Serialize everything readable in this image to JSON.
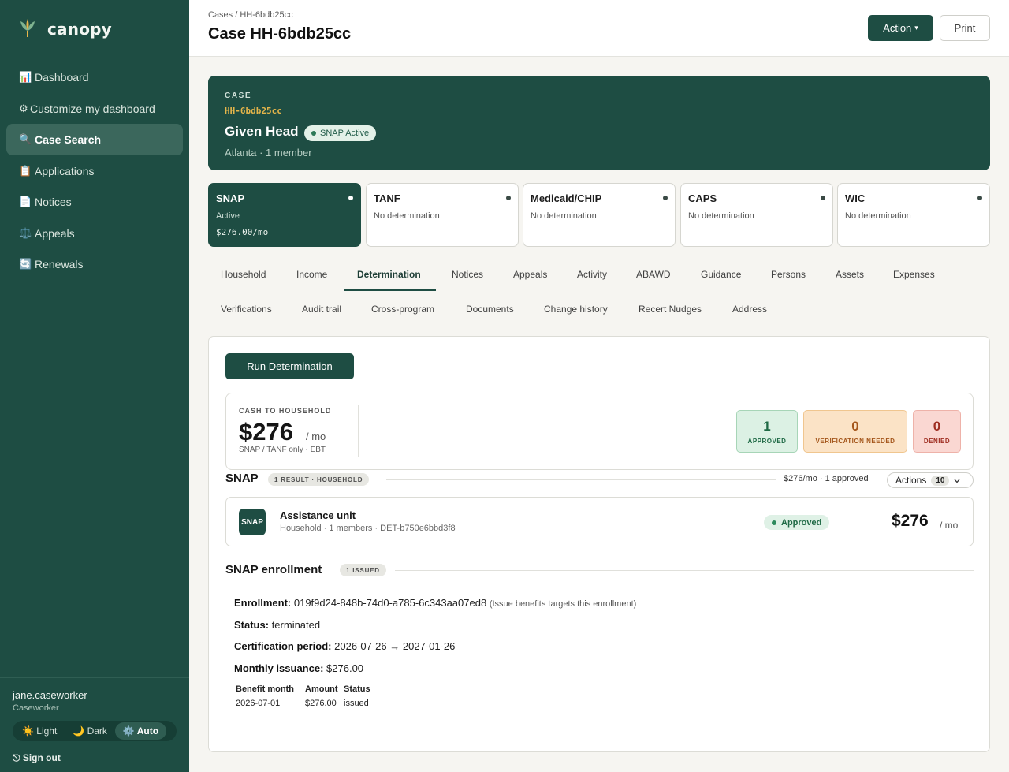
{
  "sidebar": {
    "brand": "canopy",
    "items": [
      {
        "icon": "📊",
        "label": "Dashboard"
      },
      {
        "icon": "⚙",
        "label": "Customize my dashboard"
      },
      {
        "icon": "🔍",
        "label": "Case Search"
      },
      {
        "icon": "📋",
        "label": "Applications"
      },
      {
        "icon": "📄",
        "label": "Notices"
      },
      {
        "icon": "⚖️",
        "label": "Appeals"
      },
      {
        "icon": "🔄",
        "label": "Renewals"
      }
    ],
    "active_item": "Case Search",
    "user": {
      "name": "jane.caseworker",
      "role": "Caseworker"
    },
    "theme": {
      "light": "☀️ Light",
      "dark": "🌙 Dark",
      "auto": "⚙️ Auto",
      "selected": "Auto"
    },
    "signout": "⎋ Sign out",
    "accent": "#1e4d43"
  },
  "header": {
    "breadcrumb": "Cases / HH-6bdb25cc",
    "title": "Case HH-6bdb25cc",
    "action_label": "Action",
    "action_caret": "▾",
    "print_label": "Print"
  },
  "case": {
    "label": "CASE",
    "id": "HH-6bdb25cc",
    "name": "Given Head",
    "badge": "SNAP Active",
    "subtitle": "Atlanta · 1 member"
  },
  "programs": [
    {
      "name": "SNAP",
      "status": "Active",
      "amount": "$276.00/mo"
    },
    {
      "name": "TANF",
      "status": "No determination"
    },
    {
      "name": "Medicaid/CHIP",
      "status": "No determination"
    },
    {
      "name": "CAPS",
      "status": "No determination"
    },
    {
      "name": "WIC",
      "status": "No determination"
    }
  ],
  "tabs": {
    "row1": [
      "Household",
      "Income",
      "Determination",
      "Notices",
      "Appeals",
      "Activity",
      "ABAWD",
      "Guidance",
      "Persons",
      "Assets",
      "Expenses"
    ],
    "row2": [
      "Verifications",
      "Audit trail",
      "Cross-program",
      "Documents",
      "Change history",
      "Recert Nudges",
      "Address"
    ],
    "active": "Determination"
  },
  "determination": {
    "run_label": "Run Determination",
    "summary": {
      "label": "CASH TO HOUSEHOLD",
      "amount": "$276",
      "per": "/ mo",
      "note": "SNAP / TANF only · EBT",
      "approved": {
        "value": "1",
        "label": "APPROVED"
      },
      "verification": {
        "value": "0",
        "label": "VERIFICATION NEEDED"
      },
      "denied": {
        "value": "0",
        "label": "DENIED"
      }
    },
    "snap": {
      "title": "SNAP",
      "pill": "1 RESULT · HOUSEHOLD",
      "meta": "$276/mo · 1 approved",
      "actions_label": "Actions",
      "actions_count": "10",
      "unit": {
        "icon_text": "SNAP",
        "title": "Assistance unit",
        "subtitle": "Household · 1 members · DET-b750e6bbd3f8",
        "badge": "Approved",
        "amount": "$276",
        "per": "/ mo"
      }
    },
    "enrollment": {
      "title": "SNAP enrollment",
      "pill": "1 ISSUED",
      "enrollment_label": "Enrollment:",
      "enrollment_id": "019f9d24-848b-74d0-a785-6c343aa07ed8",
      "enrollment_note": "(Issue benefits targets this enrollment)",
      "status_label": "Status:",
      "status_value": "terminated",
      "cert_label": "Certification period:",
      "cert_value": "2026-07-26 → 2027-01-26",
      "monthly_label": "Monthly issuance:",
      "monthly_value": "$276.00",
      "table": {
        "headers": [
          "Benefit month",
          "Amount",
          "Status"
        ],
        "rows": [
          [
            "2026-07-01",
            "$276.00",
            "issued"
          ]
        ]
      }
    }
  }
}
